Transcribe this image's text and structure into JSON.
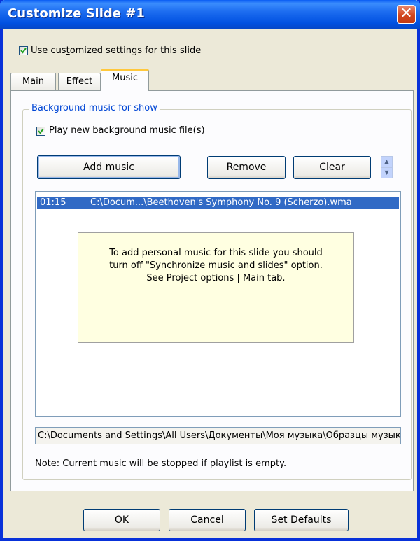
{
  "window": {
    "title": "Customize Slide #1",
    "close_glyph": "✕"
  },
  "use_custom": {
    "checked": true,
    "label_pre": "Use cus",
    "label_accel": "t",
    "label_post": "omized settings for this slide"
  },
  "tabs": [
    {
      "label": "Main",
      "active": false
    },
    {
      "label": "Effect",
      "active": false
    },
    {
      "label": "Music",
      "active": true
    }
  ],
  "music": {
    "group_title": "Background music for show",
    "play_new": {
      "checked": true,
      "label_accel": "P",
      "label_post": "lay new background music file(s)"
    },
    "buttons": {
      "add": {
        "accel": "A",
        "rest": "dd music"
      },
      "remove": {
        "accel": "R",
        "rest": "emove"
      },
      "clear": {
        "accel": "C",
        "rest": "lear"
      }
    },
    "spin": {
      "up": "▲",
      "down": "▼"
    },
    "playlist": [
      {
        "duration": "01:15",
        "path": "C:\\Docum...\\Beethoven's Symphony No. 9 (Scherzo).wma",
        "selected": true
      }
    ],
    "sync_note": {
      "line1": "To add personal music for this slide you should",
      "line2": "turn off \"Synchronize music and slides\" option.",
      "line3": "See Project options | Main tab."
    },
    "current_path": "C:\\Documents and Settings\\All Users\\Документы\\Моя музыка\\Образцы музыки",
    "note": "Note: Current music will be stopped if playlist is empty."
  },
  "footer": {
    "ok": "OK",
    "cancel": "Cancel",
    "set_defaults": {
      "accel": "S",
      "rest": "et Defaults"
    }
  },
  "colors": {
    "title_bar": "#0054e3",
    "selection": "#316ac5",
    "tab_highlight": "#ffc83c",
    "tooltip_bg": "#ffffe1"
  }
}
